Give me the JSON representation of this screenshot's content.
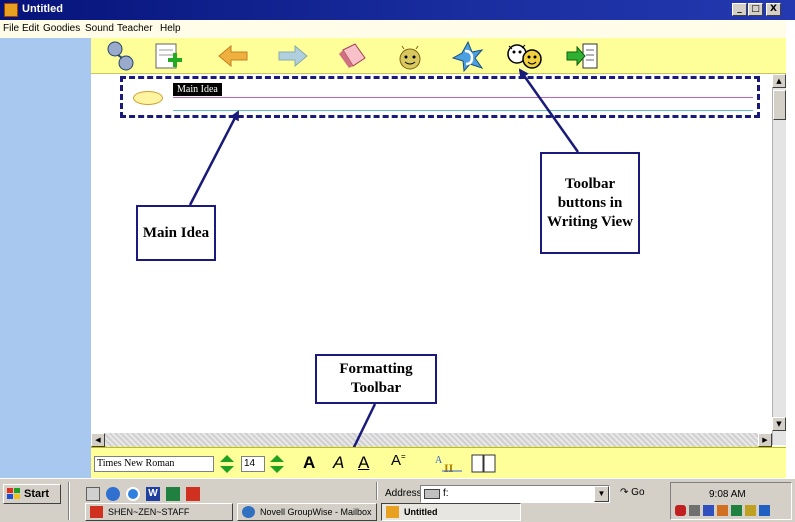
{
  "window": {
    "title": "Untitled",
    "minimize_glyph": "_",
    "maximize_glyph": "□",
    "close_glyph": "X"
  },
  "menubar": {
    "items": [
      "File",
      "Edit",
      "Goodies",
      "Sound",
      "Teacher",
      "Help"
    ]
  },
  "toolbar": {
    "icons": [
      "character-icon",
      "add-idea-icon",
      "back-arrow-icon",
      "forward-arrow-icon",
      "eraser-icon",
      "goodies-face-icon",
      "listen-ear-icon",
      "teacher-faces-icon",
      "switch-view-icon"
    ]
  },
  "document": {
    "main_idea_label": "Main Idea"
  },
  "callouts": {
    "main_idea": "Main Idea",
    "toolbar_buttons": "Toolbar buttons in Writing View",
    "formatting_toolbar": "Formatting Toolbar"
  },
  "format_toolbar": {
    "font": "Times New Roman",
    "size": "14"
  },
  "taskbar": {
    "start_label": "Start",
    "address_label": "Address",
    "address_value": "f:",
    "go_label": "Go",
    "clock": "9:08 AM",
    "tasks": [
      {
        "label": "SHEN~ZEN~STAFF",
        "active": false
      },
      {
        "label": "Novell GroupWise - Mailbox",
        "active": false
      },
      {
        "label": "Untitled",
        "active": true
      }
    ]
  },
  "colors": {
    "titlebar": "#06137a",
    "toolbar_bg": "#ffff99",
    "side_panel": "#a8c8f0",
    "callout_border": "#1a1a7a",
    "annotation_arrow": "#1a1a7a"
  }
}
